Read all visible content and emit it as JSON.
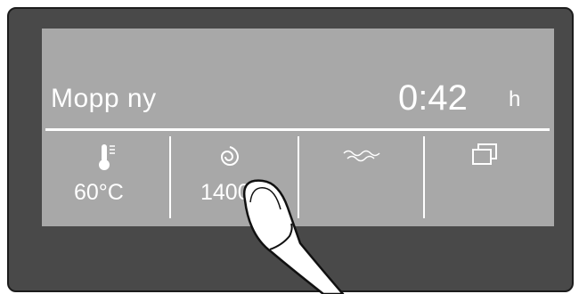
{
  "display": {
    "program_name": "Mopp ny",
    "time_remaining": "0:42",
    "time_unit": "h"
  },
  "options": [
    {
      "icon": "thermometer-icon",
      "value": "60°C"
    },
    {
      "icon": "spin-icon",
      "value": "1400"
    },
    {
      "icon": "water-wave-icon",
      "value": ""
    },
    {
      "icon": "extras-icon",
      "value": ""
    }
  ],
  "colors": {
    "panel": "#494949",
    "screen": "#a8a8a8",
    "text": "#ffffff"
  }
}
